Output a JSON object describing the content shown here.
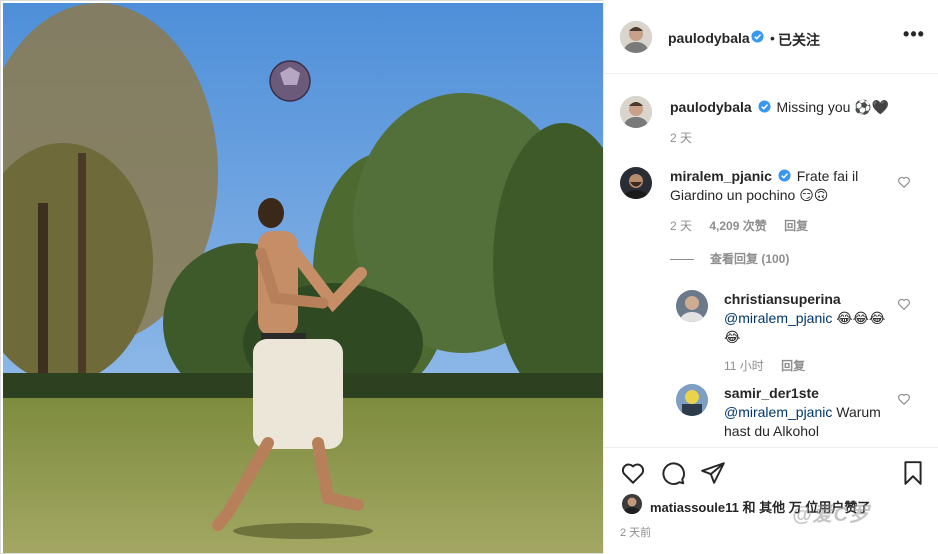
{
  "header": {
    "username": "paulodybala",
    "separator": "•",
    "follow_status": "已关注",
    "more_label": "•••"
  },
  "caption": {
    "username": "paulodybala",
    "text": "Missing you ⚽🖤",
    "time": "2 天"
  },
  "comments": [
    {
      "username": "miralem_pjanic",
      "text": "Frate fai il Giardino un pochino 😏🙃",
      "time": "2 天",
      "likes": "4,209 次赞",
      "reply_label": "回复",
      "view_replies": "查看回复 (100)",
      "replies": [
        {
          "username": "christiansuperina",
          "mention": "@miralem_pjanic",
          "text": " 😂😂😂 😂",
          "time": "11 小时",
          "reply_label": "回复"
        },
        {
          "username": "samir_der1ste",
          "mention": "@miralem_pjanic",
          "text": " Warum hast du Alkohol"
        }
      ]
    }
  ],
  "footer": {
    "liked_by_user": "matiassoule11",
    "liked_by_rest": " 和 其他",
    "liked_suffix": " 万 位用户赞了",
    "time": "2 天前",
    "watermark": "@爱C罗"
  },
  "icons": {
    "verified": "verified-badge-icon",
    "heart": "heart-icon",
    "comment": "comment-bubble-icon",
    "share": "paper-plane-icon",
    "save": "bookmark-icon"
  },
  "colors": {
    "verified_blue": "#3897f0",
    "text": "#262626",
    "muted": "#8e8e8e",
    "mention": "#00376b",
    "sky": "#6fa3e0",
    "grass": "#8a9a48"
  }
}
